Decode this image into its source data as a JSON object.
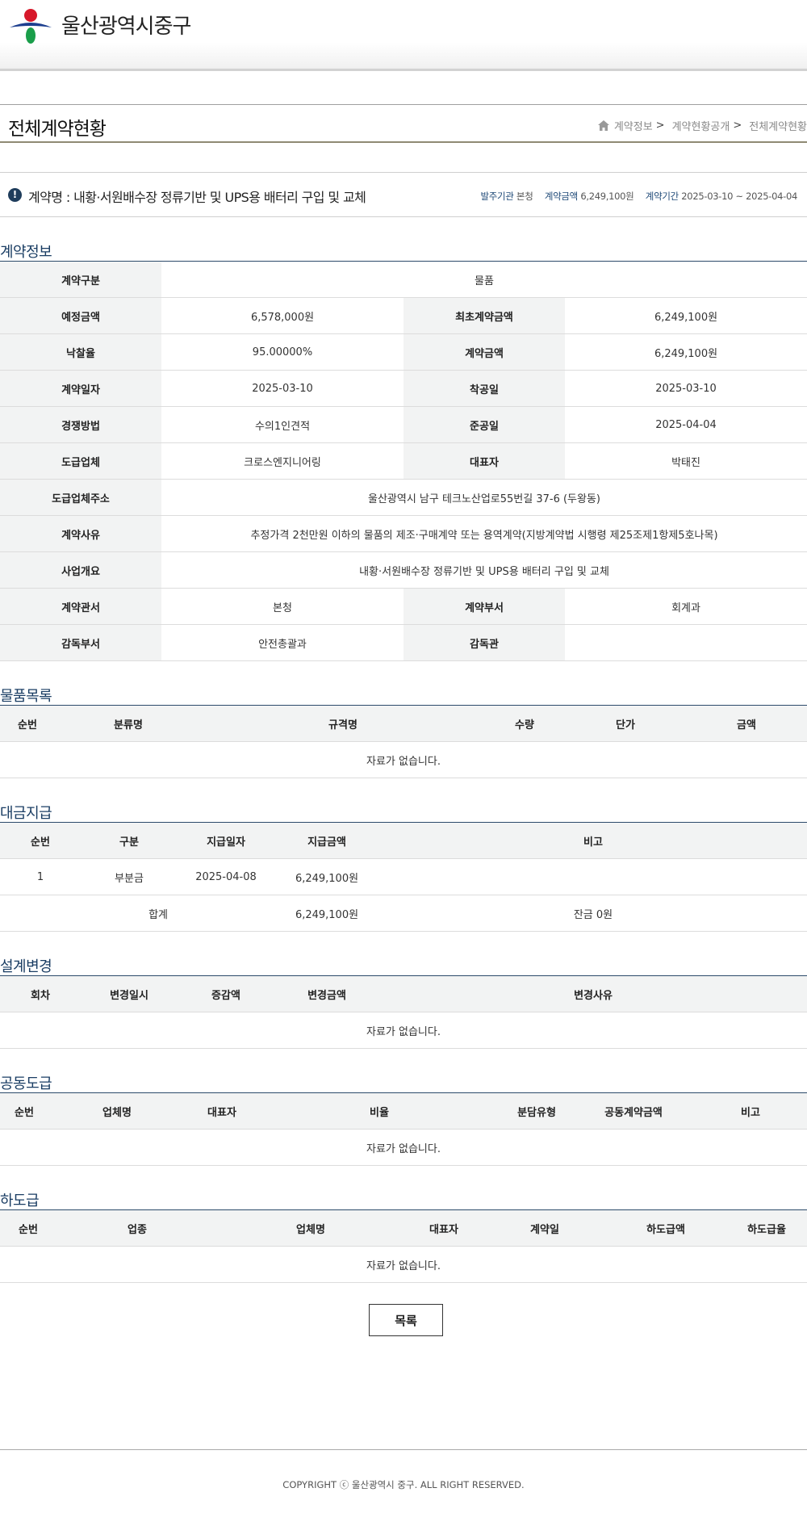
{
  "header": {
    "org_name": "울산광역시중구"
  },
  "title_bar": {
    "page_title": "전체계약현황",
    "breadcrumb": [
      "계약정보",
      "계약현황공개",
      "전체계약현황"
    ]
  },
  "summary": {
    "contract_name": "계약명 : 내황·서원배수장 정류기반 및 UPS용 배터리 구입 및 교체",
    "ordering_label": "발주기관",
    "ordering_value": "본청",
    "amount_label": "계약금액",
    "amount_value": "6,249,100원",
    "period_label": "계약기간",
    "period_value": "2025-03-10 ~ 2025-04-04"
  },
  "sections": {
    "contract_info": "계약정보",
    "goods_list": "물품목록",
    "payment": "대금지급",
    "design_change": "설계변경",
    "joint_contract": "공동도급",
    "subcontract": "하도급"
  },
  "contract_info": {
    "type_label": "계약구분",
    "type_value": "물품",
    "est_label": "예정금액",
    "est_value": "6,578,000원",
    "first_label": "최초계약금액",
    "first_value": "6,249,100원",
    "rate_label": "낙찰율",
    "rate_value": "95.00000%",
    "amt_label": "계약금액",
    "amt_value": "6,249,100원",
    "date_label": "계약일자",
    "date_value": "2025-03-10",
    "start_label": "착공일",
    "start_value": "2025-03-10",
    "method_label": "경쟁방법",
    "method_value": "수의1인견적",
    "end_label": "준공일",
    "end_value": "2025-04-04",
    "contractor_label": "도급업체",
    "contractor_value": "크로스엔지니어링",
    "rep_label": "대표자",
    "rep_value": "박태진",
    "addr_label": "도급업체주소",
    "addr_value": "울산광역시 남구 테크노산업로55번길 37-6 (두왕동)",
    "reason_label": "계약사유",
    "reason_value": "추정가격 2천만원 이하의 물품의 제조·구매계약 또는 용역계약(지방계약법 시행령 제25조제1항제5호나목)",
    "overview_label": "사업개요",
    "overview_value": "내황·서원배수장 정류기반 및 UPS용 배터리 구입 및 교체",
    "office_label": "계약관서",
    "office_value": "본청",
    "dept_label": "계약부서",
    "dept_value": "회계과",
    "supdept_label": "감독부서",
    "supdept_value": "안전총괄과",
    "supervisor_label": "감독관",
    "supervisor_value": ""
  },
  "goods_list": {
    "headers": [
      "순번",
      "분류명",
      "규격명",
      "수량",
      "단가",
      "금액"
    ],
    "empty": "자료가 없습니다."
  },
  "payment": {
    "headers": [
      "순번",
      "구분",
      "지급일자",
      "지급금액",
      "비고"
    ],
    "rows": [
      [
        "1",
        "부분금",
        "2025-04-08",
        "6,249,100원",
        ""
      ]
    ],
    "total_label": "합계",
    "total_amount": "6,249,100원",
    "total_note": "잔금 0원"
  },
  "design_change": {
    "headers": [
      "회차",
      "변경일시",
      "증감액",
      "변경금액",
      "변경사유"
    ],
    "empty": "자료가 없습니다."
  },
  "joint_contract": {
    "headers": [
      "순번",
      "업체명",
      "대표자",
      "비율",
      "분담유형",
      "공동계약금액",
      "비고"
    ],
    "empty": "자료가 없습니다."
  },
  "subcontract": {
    "headers": [
      "순번",
      "업종",
      "업체명",
      "대표자",
      "계약일",
      "하도급액",
      "하도급율"
    ],
    "empty": "자료가 없습니다."
  },
  "buttons": {
    "list": "목록"
  },
  "footer": {
    "copyright": "COPYRIGHT ⓒ 울산광역시 중구. ALL RIGHT RESERVED."
  },
  "icons": {
    "logo": "jung-gu-logo",
    "home": "home-icon",
    "info": "exclamation-icon"
  },
  "colors": {
    "section_title": "#1a3d63",
    "label_accent": "#1f4a78",
    "th_bg": "#f2f3f3"
  }
}
